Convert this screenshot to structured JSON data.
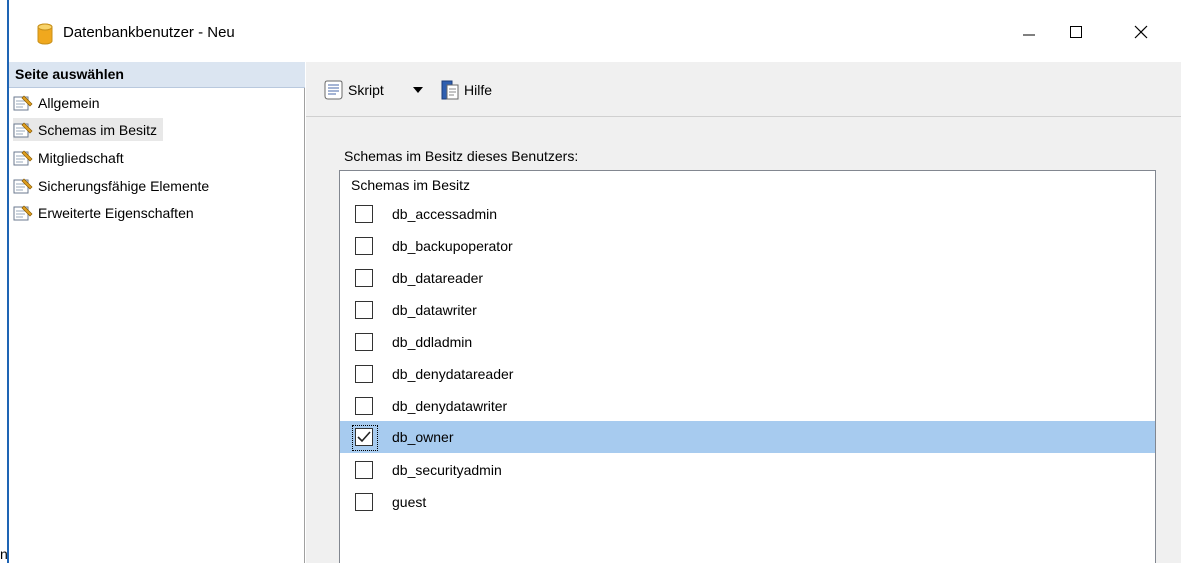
{
  "window": {
    "title": "Datenbankbenutzer - Neu",
    "icon": "database-icon",
    "controls": [
      "minimize-icon",
      "maximize-icon",
      "close-icon"
    ]
  },
  "corner_text": "n",
  "left_pane": {
    "header": "Seite auswählen",
    "items": [
      {
        "label": "Allgemein",
        "icon": "page-icon",
        "selected": false
      },
      {
        "label": "Schemas im Besitz",
        "icon": "page-icon",
        "selected": true
      },
      {
        "label": "Mitgliedschaft",
        "icon": "page-icon",
        "selected": false
      },
      {
        "label": "Sicherungsfähige Elemente",
        "icon": "page-icon",
        "selected": false
      },
      {
        "label": "Erweiterte Eigenschaften",
        "icon": "page-icon",
        "selected": false
      }
    ]
  },
  "toolbar": {
    "script_label": "Skript",
    "script_icon": "script-icon",
    "dropdown_icon": "chevron-down-icon",
    "help_label": "Hilfe",
    "help_icon": "help-icon"
  },
  "content": {
    "section_label": "Schemas im Besitz dieses Benutzers:",
    "list_header": "Schemas im Besitz",
    "rows": [
      {
        "label": "db_accessadmin",
        "checked": false,
        "selected": false
      },
      {
        "label": "db_backupoperator",
        "checked": false,
        "selected": false
      },
      {
        "label": "db_datareader",
        "checked": false,
        "selected": false
      },
      {
        "label": "db_datawriter",
        "checked": false,
        "selected": false
      },
      {
        "label": "db_ddladmin",
        "checked": false,
        "selected": false
      },
      {
        "label": "db_denydatareader",
        "checked": false,
        "selected": false
      },
      {
        "label": "db_denydatawriter",
        "checked": false,
        "selected": false
      },
      {
        "label": "db_owner",
        "checked": true,
        "selected": true
      },
      {
        "label": "db_securityadmin",
        "checked": false,
        "selected": false
      },
      {
        "label": "guest",
        "checked": false,
        "selected": false
      }
    ]
  },
  "colors": {
    "selection": "#a7cbef",
    "header_bg": "#dbe5f1",
    "accent": "#1e64b4"
  }
}
